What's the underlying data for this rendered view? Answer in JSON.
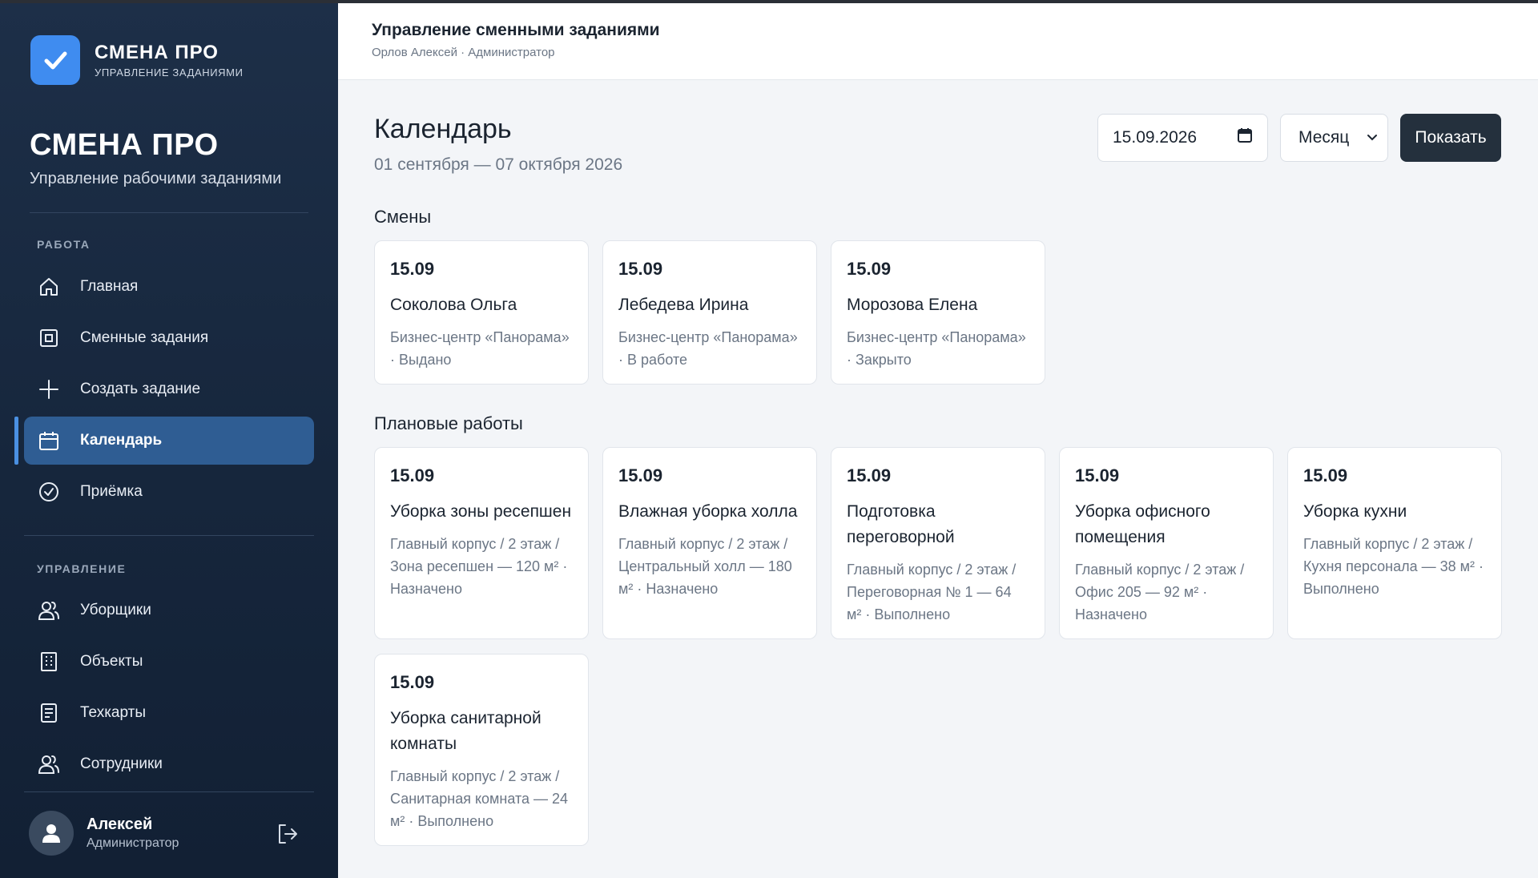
{
  "app": {
    "brand_name": "СМЕНА ПРО",
    "brand_sub": "УПРАВЛЕНИЕ ЗАДАНИЯМИ",
    "big_title": "СМЕНА ПРО",
    "big_sub": "Управление рабочими заданиями"
  },
  "sidebar": {
    "section_work": "РАБОТА",
    "section_manage": "УПРАВЛЕНИЕ",
    "work_items": [
      {
        "label": "Главная",
        "icon": "home-icon"
      },
      {
        "label": "Сменные задания",
        "icon": "square-icon"
      },
      {
        "label": "Создать задание",
        "icon": "plus-icon"
      },
      {
        "label": "Календарь",
        "icon": "calendar-icon",
        "active": true
      },
      {
        "label": "Приёмка",
        "icon": "check-circle-icon"
      }
    ],
    "manage_items": [
      {
        "label": "Уборщики",
        "icon": "users-icon"
      },
      {
        "label": "Объекты",
        "icon": "building-icon"
      },
      {
        "label": "Техкарты",
        "icon": "document-icon"
      },
      {
        "label": "Сотрудники",
        "icon": "users-icon"
      }
    ],
    "user": {
      "name": "Алексей",
      "role": "Администратор"
    }
  },
  "header": {
    "title": "Управление сменными заданиями",
    "subtitle": "Орлов Алексей · Администратор"
  },
  "page": {
    "title": "Календарь",
    "range": "01 сентября — 07 октября 2026",
    "date_value": "15.09.2026",
    "period_value": "Месяц",
    "show_label": "Показать"
  },
  "shifts": {
    "title": "Смены",
    "items": [
      {
        "date": "15.09",
        "name": "Соколова Ольга",
        "meta": "Бизнес-центр «Панорама» · Выдано"
      },
      {
        "date": "15.09",
        "name": "Лебедева Ирина",
        "meta": "Бизнес-центр «Панорама» · В работе"
      },
      {
        "date": "15.09",
        "name": "Морозова Елена",
        "meta": "Бизнес-центр «Панорама» · Закрыто"
      }
    ]
  },
  "planned": {
    "title": "Плановые работы",
    "items": [
      {
        "date": "15.09",
        "name": "Уборка зоны ресепшен",
        "meta": "Главный корпус / 2 этаж / Зона ресепшен — 120 м² · Назначено"
      },
      {
        "date": "15.09",
        "name": "Влажная уборка холла",
        "meta": "Главный корпус / 2 этаж / Центральный холл — 180 м² · Назначено"
      },
      {
        "date": "15.09",
        "name": "Подготовка переговорной",
        "meta": "Главный корпус / 2 этаж / Переговорная № 1 — 64 м² · Выполнено"
      },
      {
        "date": "15.09",
        "name": "Уборка офисного помещения",
        "meta": "Главный корпус / 2 этаж / Офис 205 — 92 м² · Назначено"
      },
      {
        "date": "15.09",
        "name": "Уборка кухни",
        "meta": "Главный корпус / 2 этаж / Кухня персонала — 38 м² · Выполнено"
      },
      {
        "date": "15.09",
        "name": "Уборка санитарной комнаты",
        "meta": "Главный корпус / 2 этаж / Санитарная комната — 24 м² · Выполнено"
      }
    ]
  }
}
